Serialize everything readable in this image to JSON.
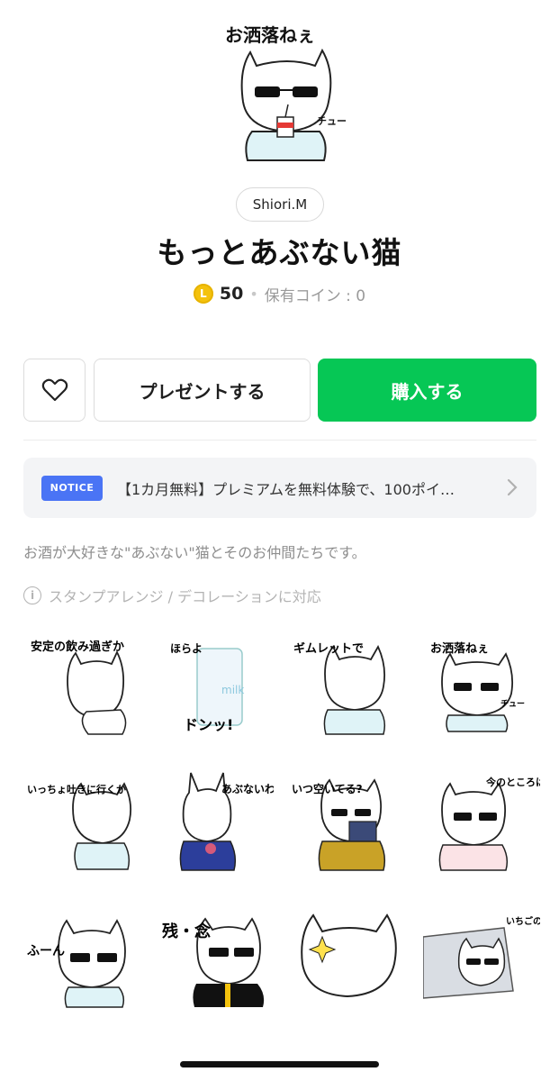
{
  "hero": {
    "caption": "お洒落ねぇ",
    "sfx": "チュー"
  },
  "creator": "Shiori.M",
  "title": "もっとあぶない猫",
  "price": {
    "coin_letter": "L",
    "amount": "50",
    "separator": "•",
    "owned": "保有コイン : 0"
  },
  "buttons": {
    "favorite": "heart-icon",
    "gift": "プレゼントする",
    "buy": "購入する"
  },
  "notice": {
    "badge": "NOTICE",
    "text": "【1カ月無料】プレミアムを無料体験で、100ポイ…"
  },
  "description": "お酒が大好きな\"あぶない\"猫とそのお仲間たちです。",
  "feature": {
    "icon_text": "i",
    "text": "スタンプアレンジ / デコレーションに対応"
  },
  "stickers": [
    {
      "caption": "安定の飲み過ぎか"
    },
    {
      "caption": "ほらよ",
      "extra": "ドンッ!",
      "label": "milk"
    },
    {
      "caption": "ギムレットで"
    },
    {
      "caption": "お洒落ねぇ",
      "extra": "チュー"
    },
    {
      "caption": "いっちょ吐きに行くか"
    },
    {
      "caption": "あぶないわ〜"
    },
    {
      "caption": "いつ空いてる?"
    },
    {
      "caption": "今のところは"
    },
    {
      "caption": "ふーん"
    },
    {
      "caption": "残・念"
    },
    {
      "caption": ""
    },
    {
      "caption": "いちごの歯磨き粉ある?"
    }
  ],
  "colors": {
    "buy": "#06c755",
    "notice_badge": "#4a74f5",
    "coin": "#f4c20d"
  }
}
